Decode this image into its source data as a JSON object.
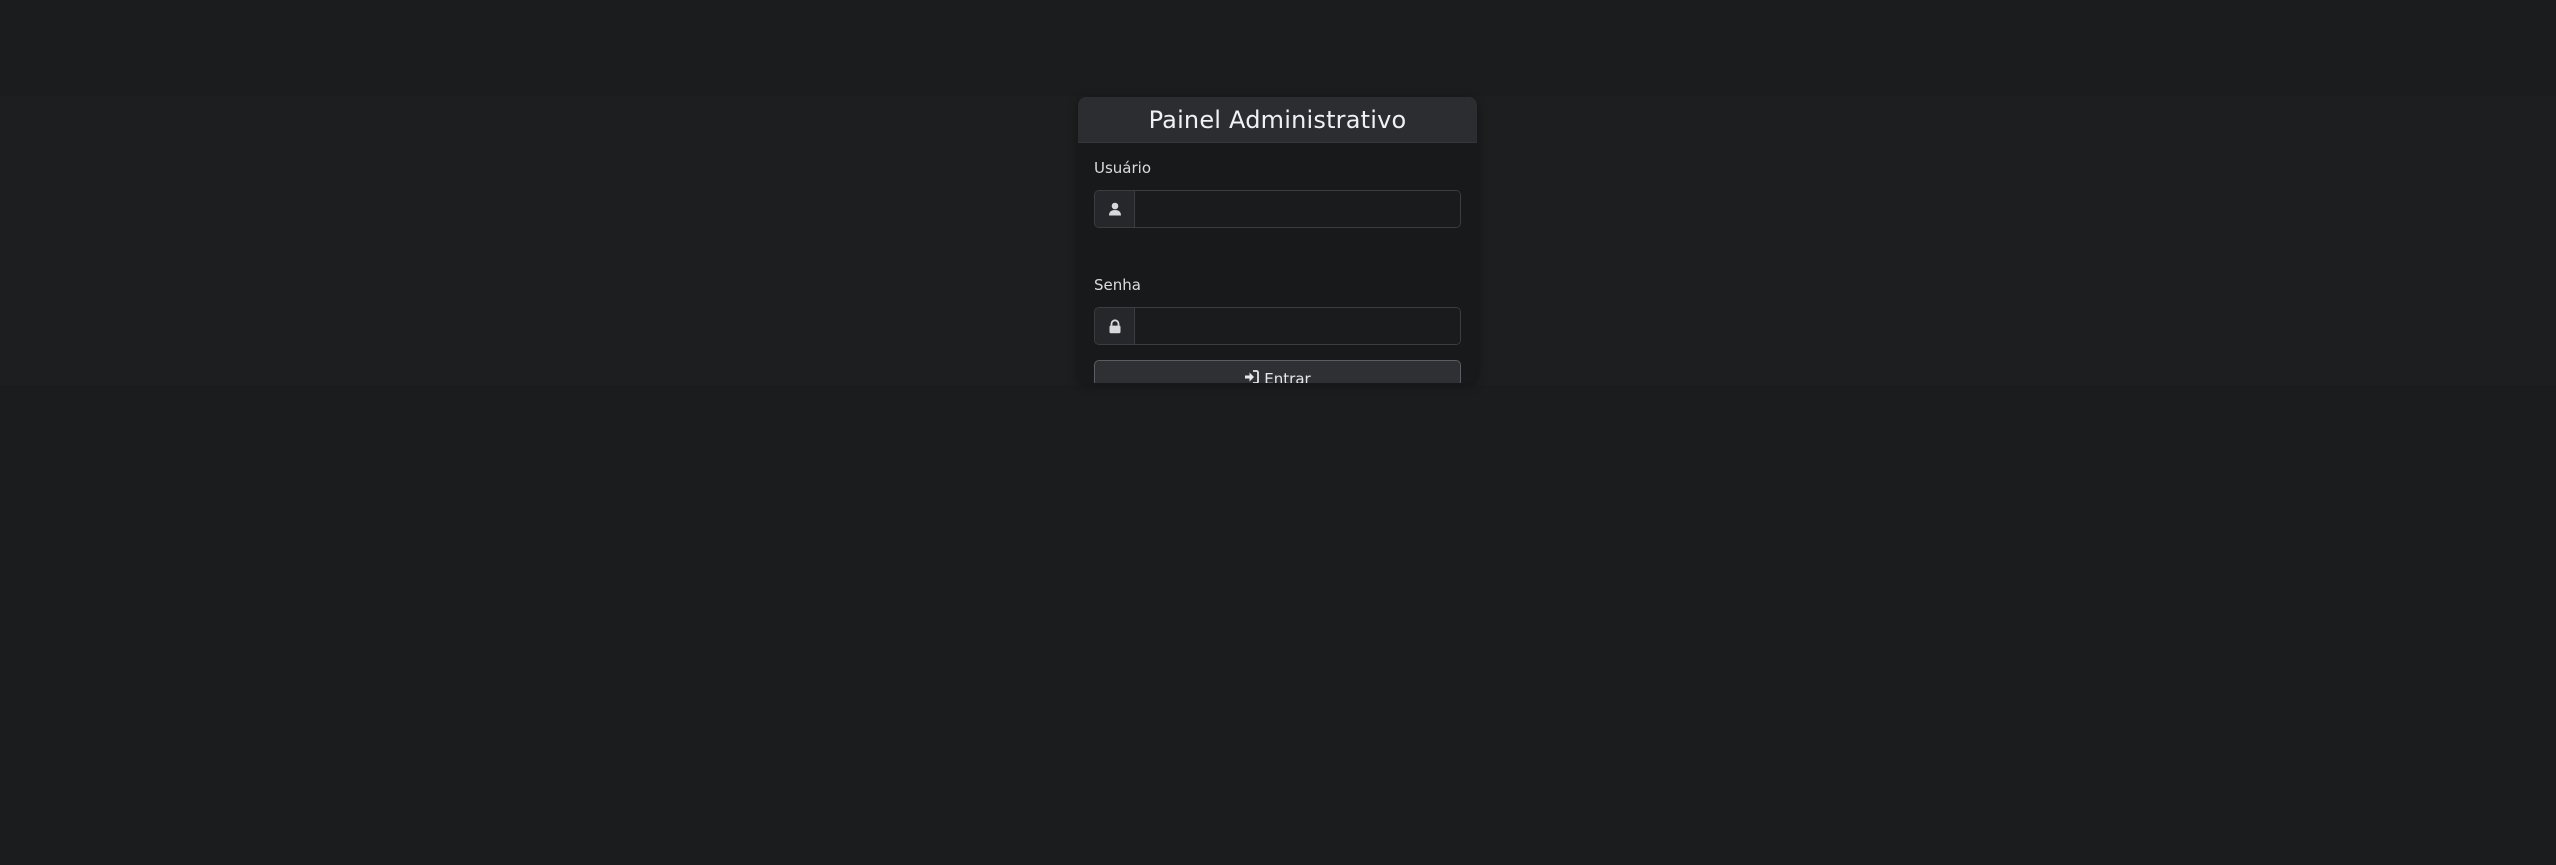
{
  "login": {
    "title": "Painel Administrativo",
    "username": {
      "label": "Usuário",
      "value": "",
      "icon": "user-icon"
    },
    "password": {
      "label": "Senha",
      "value": "",
      "icon": "lock-icon"
    },
    "submit": {
      "label": "Entrar",
      "icon": "sign-in-icon"
    }
  },
  "colors": {
    "page_background": "#1b1c1e",
    "card_header": "#2b2d31",
    "button": "#2e3034"
  }
}
